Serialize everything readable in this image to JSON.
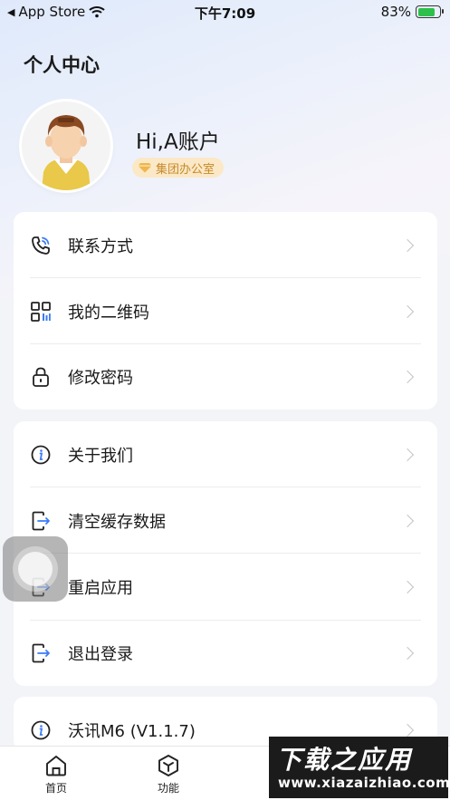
{
  "status_bar": {
    "back_app": "App Store",
    "time": "下午7:09",
    "battery": "83%"
  },
  "page_title": "个人中心",
  "profile": {
    "greeting": "Hi,A账户",
    "role": "集团办公室"
  },
  "menu_group_1": [
    {
      "label": "联系方式",
      "icon": "phone-icon"
    },
    {
      "label": "我的二维码",
      "icon": "qrcode-icon"
    },
    {
      "label": "修改密码",
      "icon": "lock-icon"
    }
  ],
  "menu_group_2": [
    {
      "label": "关于我们",
      "icon": "info-icon"
    },
    {
      "label": "清空缓存数据",
      "icon": "exit-icon"
    },
    {
      "label": "重启应用",
      "icon": "exit-icon"
    },
    {
      "label": "退出登录",
      "icon": "exit-icon"
    }
  ],
  "menu_group_3": [
    {
      "label": "沃讯M6 (V1.1.7)",
      "icon": "info-icon"
    }
  ],
  "tabbar": [
    {
      "label": "首页",
      "icon": "home-icon"
    },
    {
      "label": "功能",
      "icon": "cube-icon"
    }
  ],
  "watermark": {
    "title": "下载之应用",
    "url": "www.xiazaizhiao.com"
  },
  "colors": {
    "accent": "#1a1a1a",
    "badge_bg": "#fbe8c6",
    "badge_text": "#c58a2b"
  }
}
